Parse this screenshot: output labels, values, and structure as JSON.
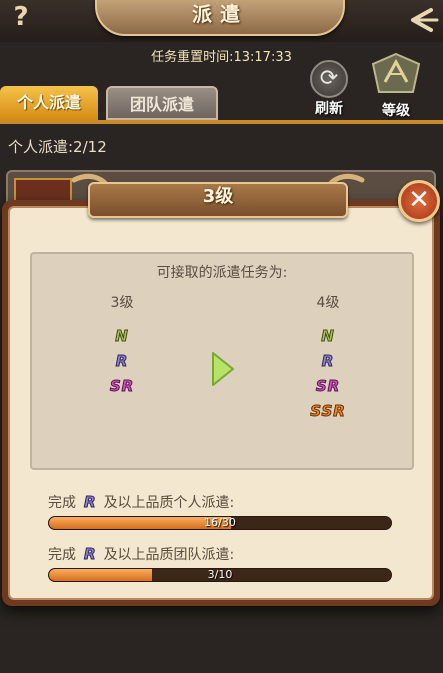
{
  "header": {
    "title": "派遣",
    "help_label": "?"
  },
  "reset": {
    "text": "任务重置时间:13:17:33"
  },
  "tabs": [
    {
      "label": "个人派遣",
      "active": true
    },
    {
      "label": "团队派遣",
      "active": false
    }
  ],
  "actions": {
    "refresh_label": "刷新",
    "level_label": "等级"
  },
  "dispatch": {
    "count_text": "个人派遣:2/12"
  },
  "modal": {
    "title": "3级",
    "close_label": "✕",
    "heading": "可接取的派遣任务为:",
    "current_level": {
      "label": "3级",
      "ranks": [
        "N",
        "R",
        "SR"
      ]
    },
    "next_level": {
      "label": "4级",
      "ranks": [
        "N",
        "R",
        "SR",
        "SSR"
      ]
    },
    "progress": [
      {
        "prefix": "完成",
        "rank": "R",
        "suffix": "及以上品质个人派遣:",
        "text": "16/30",
        "current": 16,
        "total": 30
      },
      {
        "prefix": "完成",
        "rank": "R",
        "suffix": "及以上品质团队派遣:",
        "text": "3/10",
        "current": 3,
        "total": 10
      }
    ]
  },
  "colors": {
    "accent": "#d58c14",
    "progress_fill": "#e8862a",
    "modal_frame": "#6d3a20"
  }
}
